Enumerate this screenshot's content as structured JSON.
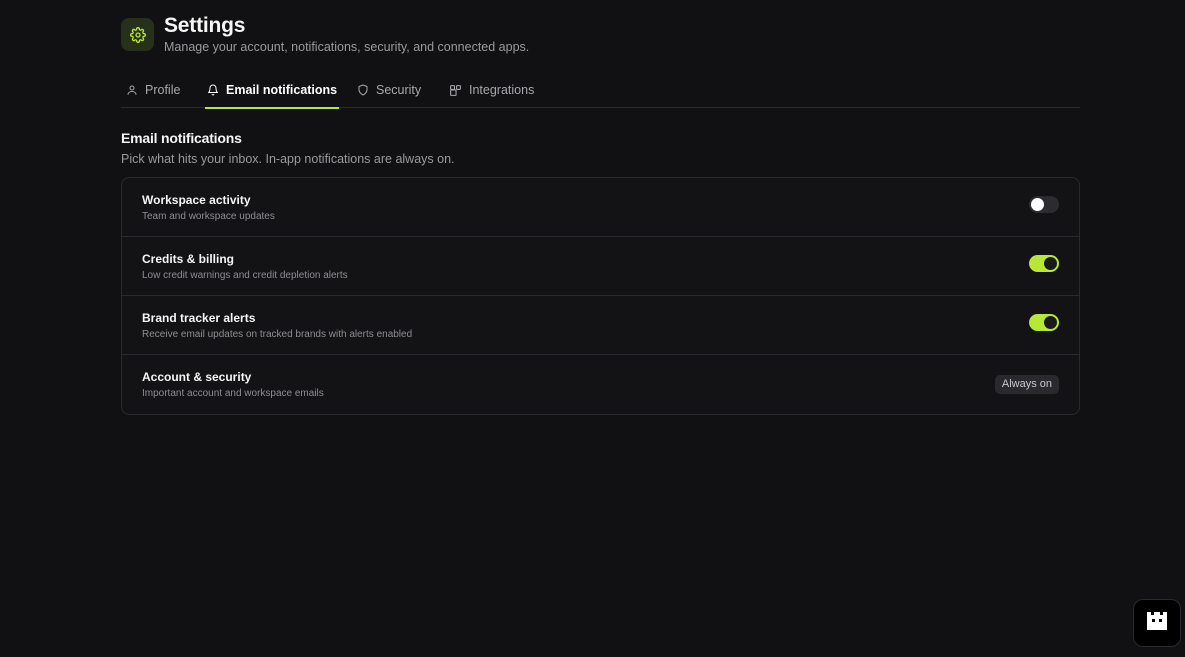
{
  "header": {
    "icon": "gear-icon",
    "title": "Settings",
    "subtitle": "Manage your account, notifications, security, and connected apps."
  },
  "tabs": [
    {
      "label": "Profile",
      "icon": "user-icon",
      "active": false
    },
    {
      "label": "Email notifications",
      "icon": "bell-icon",
      "active": true
    },
    {
      "label": "Security",
      "icon": "shield-icon",
      "active": false
    },
    {
      "label": "Integrations",
      "icon": "integrations-icon",
      "active": false
    }
  ],
  "section": {
    "title": "Email notifications",
    "subtitle": "Pick what hits your inbox. In-app notifications are always on."
  },
  "settings": [
    {
      "title": "Workspace activity",
      "description": "Team and workspace updates",
      "control": "toggle",
      "enabled": false
    },
    {
      "title": "Credits & billing",
      "description": "Low credit warnings and credit depletion alerts",
      "control": "toggle",
      "enabled": true
    },
    {
      "title": "Brand tracker alerts",
      "description": "Receive email updates on tracked brands with alerts enabled",
      "control": "toggle",
      "enabled": true
    },
    {
      "title": "Account & security",
      "description": "Important account and workspace emails",
      "control": "badge",
      "badge_label": "Always on"
    }
  ],
  "colors": {
    "background": "#111113",
    "accent": "#b6e835",
    "border": "#2a2a2e"
  },
  "corner_button": {
    "icon": "castle-icon"
  }
}
